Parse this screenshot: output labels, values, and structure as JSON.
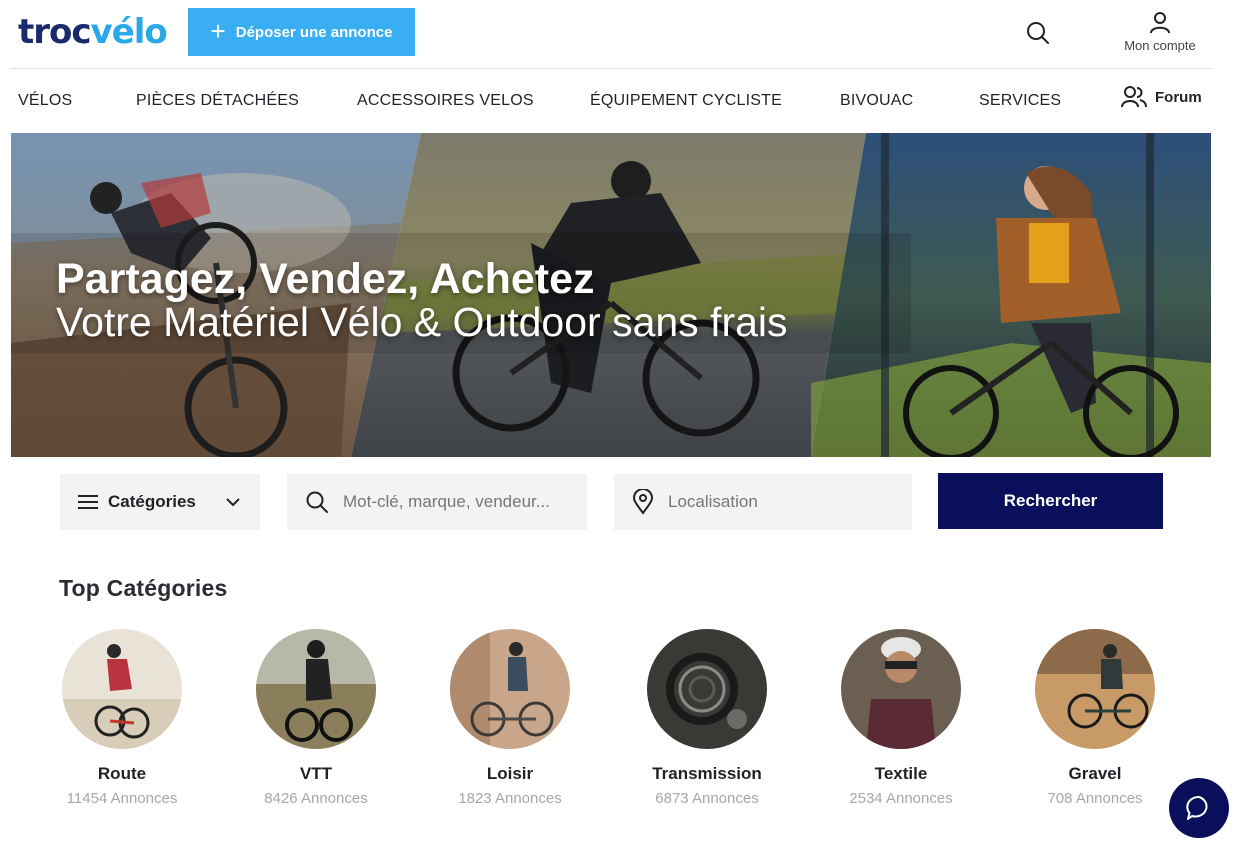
{
  "header": {
    "logo_part1": "troc",
    "logo_part2": "vélo",
    "post_button_label": "Déposer une annonce",
    "account_label": "Mon compte"
  },
  "nav": {
    "items": [
      {
        "label": "VÉLOS"
      },
      {
        "label": "PIÈCES DÉTACHÉES"
      },
      {
        "label": "ACCESSOIRES VELOS"
      },
      {
        "label": "ÉQUIPEMENT CYCLISTE"
      },
      {
        "label": "BIVOUAC"
      },
      {
        "label": "SERVICES"
      }
    ],
    "forum_label": "Forum"
  },
  "hero": {
    "title": "Partagez, Vendez, Achetez",
    "subtitle": "Votre Matériel Vélo & Outdoor sans frais"
  },
  "search": {
    "categories_label": "Catégories",
    "keyword_placeholder": "Mot-clé, marque, vendeur...",
    "location_placeholder": "Localisation",
    "button_label": "Rechercher"
  },
  "top_categories": {
    "title": "Top Catégories",
    "items": [
      {
        "name": "Route",
        "count": "11454 Annonces"
      },
      {
        "name": "VTT",
        "count": "8426 Annonces"
      },
      {
        "name": "Loisir",
        "count": "1823 Annonces"
      },
      {
        "name": "Transmission",
        "count": "6873 Annonces"
      },
      {
        "name": "Textile",
        "count": "2534 Annonces"
      },
      {
        "name": "Gravel",
        "count": "708 Annonces"
      }
    ]
  },
  "colors": {
    "brand_dark": "#1a2a6c",
    "brand_light": "#2aa8e8",
    "post_button": "#3aaef2",
    "search_button": "#0a0f5c",
    "chat_button": "#0a0f5c"
  },
  "icons": {
    "header_search": "search-icon",
    "account": "user-icon",
    "forum": "users-icon",
    "categories_menu": "menu-icon",
    "categories_chevron": "chevron-down-icon",
    "keyword": "search-icon",
    "location": "map-pin-icon",
    "chat": "chat-bubble-icon"
  }
}
